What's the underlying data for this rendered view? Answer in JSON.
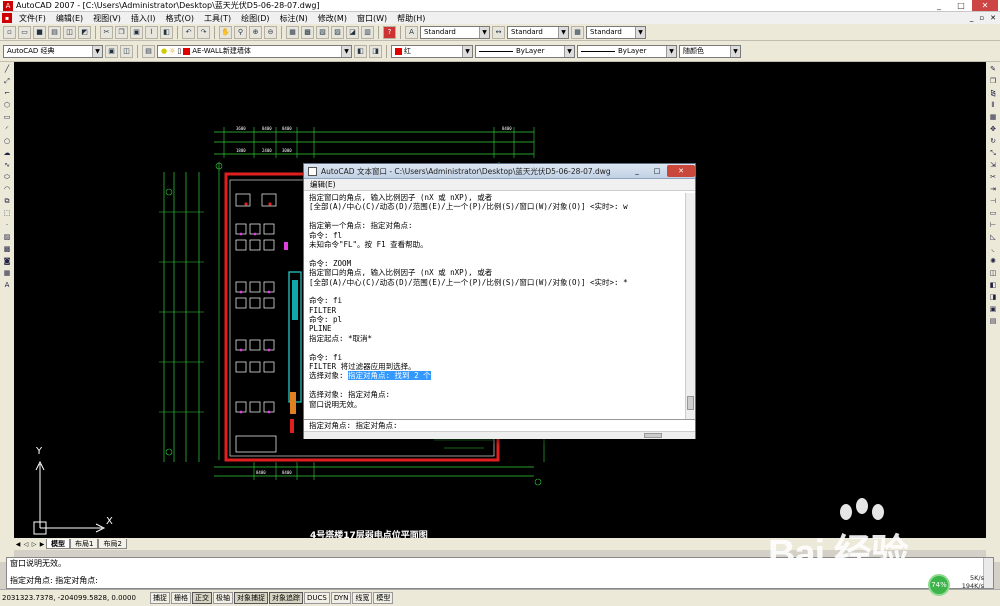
{
  "window": {
    "title": "AutoCAD 2007 - [C:\\Users\\Administrator\\Desktop\\蓝天光伏D5-06-28-07.dwg]",
    "controls": [
      "_",
      "□",
      "✕"
    ]
  },
  "menubar": {
    "items": [
      "文件(F)",
      "编辑(E)",
      "视图(V)",
      "插入(I)",
      "格式(O)",
      "工具(T)",
      "绘图(D)",
      "标注(N)",
      "修改(M)",
      "窗口(W)",
      "帮助(H)"
    ]
  },
  "toolbar1": {
    "text_style": "Standard",
    "dim_style": "Standard",
    "table_style": "Standard"
  },
  "toolbar2": {
    "workspace": "AutoCAD 经典",
    "layer": "AE-WALL新建墙体",
    "color": "红",
    "linetype": "ByLayer",
    "lineweight": "ByLayer",
    "plotstyle": "随颜色",
    "color_hex": "#e00000"
  },
  "drawing": {
    "title": "4号塔楼17层弱电点位平面图",
    "ucs_y": "Y",
    "ucs_x": "X"
  },
  "tabs": [
    "模型",
    "布局1",
    "布局2"
  ],
  "command_window": {
    "lines": [
      "窗口说明无效。",
      "指定对角点: 指定对角点:"
    ]
  },
  "status": {
    "coords": "2031323.7378,  -204099.5828,  0.0000",
    "buttons": [
      "捕捉",
      "栅格",
      "正交",
      "极轴",
      "对象捕捉",
      "对象追踪",
      "DUCS",
      "DYN",
      "线宽",
      "模型"
    ]
  },
  "text_window": {
    "title": "AutoCAD 文本窗口 - C:\\Users\\Administrator\\Desktop\\蓝天光伏D5-06-28-07.dwg",
    "menu": "编辑(E)",
    "lines": [
      "指定窗口的角点, 输入比例因子 (nX 或 nXP), 或者",
      "[全部(A)/中心(C)/动态(D)/范围(E)/上一个(P)/比例(S)/窗口(W)/对象(O)] <实时>: w",
      "",
      "指定第一个角点: 指定对角点:",
      "命令: fl",
      "未知命令\"FL\"。按 F1 查看帮助。",
      "",
      "命令:  ZOOM",
      "指定窗口的角点, 输入比例因子 (nX 或 nXP), 或者",
      "[全部(A)/中心(C)/动态(D)/范围(E)/上一个(P)/比例(S)/窗口(W)/对象(O)] <实时>: *",
      "",
      "命令: fi",
      "FILTER",
      "命令: pl",
      "PLINE",
      "指定起点: *取消*",
      "",
      "命令: fi",
      "FILTER 将过滤器应用到选择。",
      "",
      "",
      "选择对象: 指定对角点:",
      "窗口说明无效。"
    ],
    "selected_prefix": "选择对象: ",
    "selected_text": "指定对角点: 找到 2 个",
    "input_line": "指定对角点: 指定对角点:"
  },
  "watermark": {
    "brand": "Bai 经验",
    "url": "jingyan.baidu.com"
  },
  "tray": {
    "cpu": "74%",
    "up": "5K/s",
    "down": "194K/s"
  }
}
